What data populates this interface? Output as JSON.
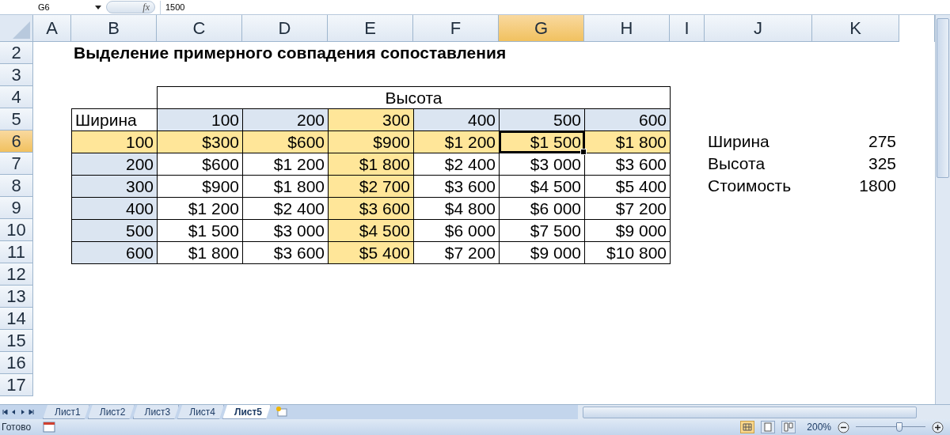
{
  "formula_bar": {
    "name_box": "G6",
    "function_label": "fx",
    "formula": "1500"
  },
  "columns": [
    {
      "label": "A",
      "selected": false
    },
    {
      "label": "B",
      "selected": false
    },
    {
      "label": "C",
      "selected": false
    },
    {
      "label": "D",
      "selected": false
    },
    {
      "label": "E",
      "selected": false
    },
    {
      "label": "F",
      "selected": false
    },
    {
      "label": "G",
      "selected": true
    },
    {
      "label": "H",
      "selected": false
    },
    {
      "label": "I",
      "selected": false
    },
    {
      "label": "J",
      "selected": false
    },
    {
      "label": "K",
      "selected": false
    }
  ],
  "rows": [
    {
      "label": "2",
      "selected": false
    },
    {
      "label": "3",
      "selected": false
    },
    {
      "label": "4",
      "selected": false
    },
    {
      "label": "5",
      "selected": false
    },
    {
      "label": "6",
      "selected": true
    },
    {
      "label": "7",
      "selected": false
    },
    {
      "label": "8",
      "selected": false
    },
    {
      "label": "9",
      "selected": false
    },
    {
      "label": "10",
      "selected": false
    },
    {
      "label": "11",
      "selected": false
    },
    {
      "label": "12",
      "selected": false
    },
    {
      "label": "13",
      "selected": false
    },
    {
      "label": "14",
      "selected": false
    },
    {
      "label": "15",
      "selected": false
    },
    {
      "label": "16",
      "selected": false
    },
    {
      "label": "17",
      "selected": false
    }
  ],
  "title": "Выделение примерного совпадения сопоставления",
  "table": {
    "header": "Высота",
    "width_label": "Ширина",
    "heights": [
      {
        "text": "100",
        "highlighted": false
      },
      {
        "text": "200",
        "highlighted": false
      },
      {
        "text": "300",
        "highlighted": true
      },
      {
        "text": "400",
        "highlighted": false
      },
      {
        "text": "500",
        "highlighted": false
      },
      {
        "text": "600",
        "highlighted": false
      }
    ],
    "rows": [
      {
        "width": {
          "text": "100",
          "highlighted": true
        },
        "values": [
          {
            "text": "$300",
            "highlighted": true,
            "selected": false
          },
          {
            "text": "$600",
            "highlighted": true,
            "selected": false
          },
          {
            "text": "$900",
            "highlighted": true,
            "selected": false
          },
          {
            "text": "$1 200",
            "highlighted": true,
            "selected": false
          },
          {
            "text": "$1 500",
            "highlighted": true,
            "selected": true
          },
          {
            "text": "$1 800",
            "highlighted": true,
            "selected": false
          }
        ]
      },
      {
        "width": {
          "text": "200",
          "highlighted": false
        },
        "values": [
          {
            "text": "$600",
            "highlighted": false,
            "selected": false
          },
          {
            "text": "$1 200",
            "highlighted": false,
            "selected": false
          },
          {
            "text": "$1 800",
            "highlighted": true,
            "selected": false
          },
          {
            "text": "$2 400",
            "highlighted": false,
            "selected": false
          },
          {
            "text": "$3 000",
            "highlighted": false,
            "selected": false
          },
          {
            "text": "$3 600",
            "highlighted": false,
            "selected": false
          }
        ]
      },
      {
        "width": {
          "text": "300",
          "highlighted": false
        },
        "values": [
          {
            "text": "$900",
            "highlighted": false,
            "selected": false
          },
          {
            "text": "$1 800",
            "highlighted": false,
            "selected": false
          },
          {
            "text": "$2 700",
            "highlighted": true,
            "selected": false
          },
          {
            "text": "$3 600",
            "highlighted": false,
            "selected": false
          },
          {
            "text": "$4 500",
            "highlighted": false,
            "selected": false
          },
          {
            "text": "$5 400",
            "highlighted": false,
            "selected": false
          }
        ]
      },
      {
        "width": {
          "text": "400",
          "highlighted": false
        },
        "values": [
          {
            "text": "$1 200",
            "highlighted": false,
            "selected": false
          },
          {
            "text": "$2 400",
            "highlighted": false,
            "selected": false
          },
          {
            "text": "$3 600",
            "highlighted": true,
            "selected": false
          },
          {
            "text": "$4 800",
            "highlighted": false,
            "selected": false
          },
          {
            "text": "$6 000",
            "highlighted": false,
            "selected": false
          },
          {
            "text": "$7 200",
            "highlighted": false,
            "selected": false
          }
        ]
      },
      {
        "width": {
          "text": "500",
          "highlighted": false
        },
        "values": [
          {
            "text": "$1 500",
            "highlighted": false,
            "selected": false
          },
          {
            "text": "$3 000",
            "highlighted": false,
            "selected": false
          },
          {
            "text": "$4 500",
            "highlighted": true,
            "selected": false
          },
          {
            "text": "$6 000",
            "highlighted": false,
            "selected": false
          },
          {
            "text": "$7 500",
            "highlighted": false,
            "selected": false
          },
          {
            "text": "$9 000",
            "highlighted": false,
            "selected": false
          }
        ]
      },
      {
        "width": {
          "text": "600",
          "highlighted": false
        },
        "values": [
          {
            "text": "$1 800",
            "highlighted": false,
            "selected": false
          },
          {
            "text": "$3 600",
            "highlighted": false,
            "selected": false
          },
          {
            "text": "$5 400",
            "highlighted": true,
            "selected": false
          },
          {
            "text": "$7 200",
            "highlighted": false,
            "selected": false
          },
          {
            "text": "$9 000",
            "highlighted": false,
            "selected": false
          },
          {
            "text": "$10 800",
            "highlighted": false,
            "selected": false
          }
        ]
      }
    ]
  },
  "summary": [
    {
      "label": "Ширина",
      "value": "275"
    },
    {
      "label": "Высота",
      "value": "325"
    },
    {
      "label": "Стоимость",
      "value": "1800"
    }
  ],
  "sheet_tabs": [
    {
      "label": "Лист1",
      "selected": false
    },
    {
      "label": "Лист2",
      "selected": false
    },
    {
      "label": "Лист3",
      "selected": false
    },
    {
      "label": "Лист4",
      "selected": false
    },
    {
      "label": "Лист5",
      "selected": true
    }
  ],
  "status_bar": {
    "status": "Готово",
    "zoom": "200%",
    "zoom_slider": {
      "level": 0.62
    }
  }
}
